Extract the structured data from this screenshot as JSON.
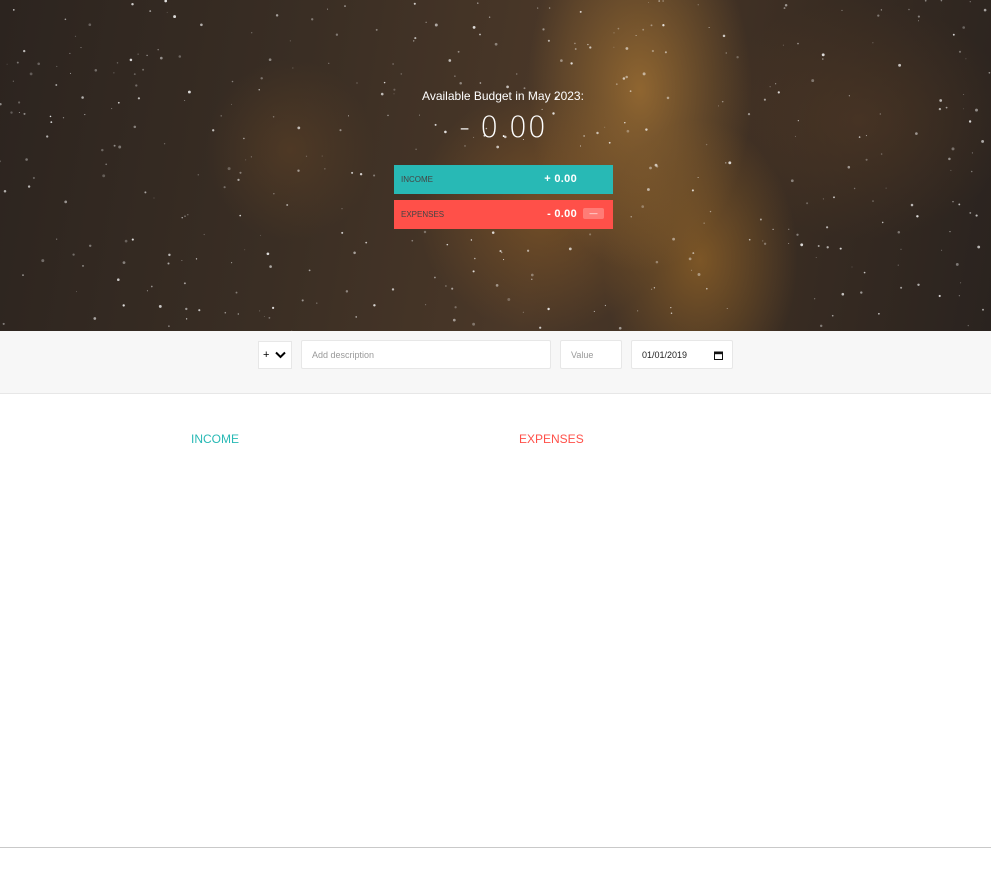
{
  "budget": {
    "title": "Available Budget in May 2023:",
    "value": "- 0.00"
  },
  "summary": {
    "income_label": "INCOME",
    "income_value": "+ 0.00",
    "expenses_label": "EXPENSES",
    "expenses_value": "- 0.00",
    "expenses_percentage": "—"
  },
  "add_form": {
    "type_value": "+",
    "description_placeholder": "Add description",
    "value_placeholder": "Value",
    "date_value": "01/01/2019"
  },
  "lists": {
    "income_title": "INCOME",
    "expenses_title": "EXPENSES"
  },
  "colors": {
    "income": "#28b9b5",
    "expenses": "#ff5049",
    "add_bar_bg": "#f7f7f7"
  },
  "icons": {
    "type_select": "chevron-down-icon",
    "date_field": "calendar-icon"
  }
}
